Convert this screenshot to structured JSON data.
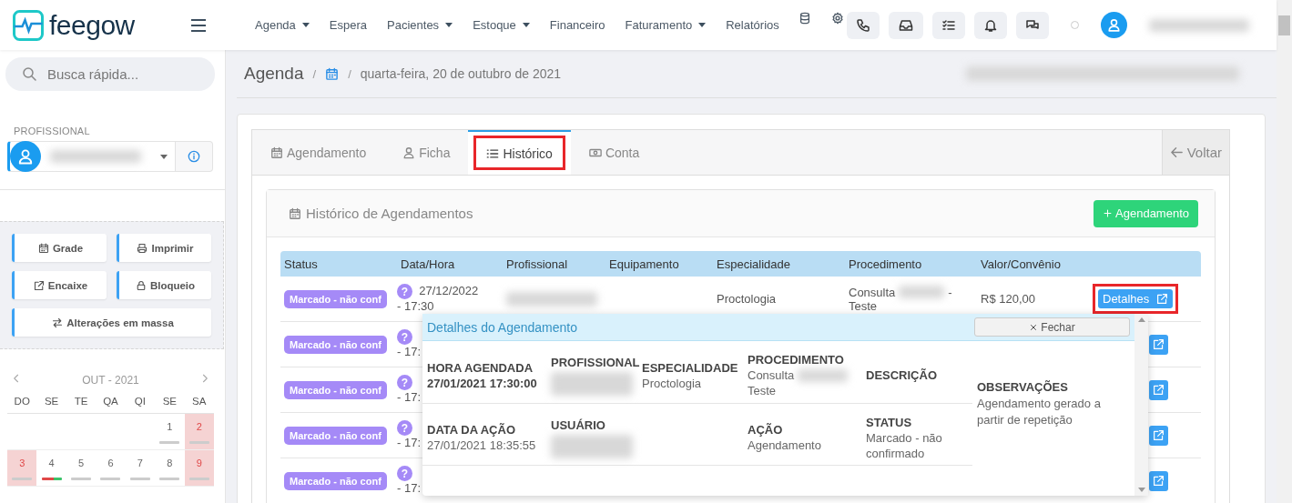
{
  "brand": {
    "name": "feegow"
  },
  "nav": [
    {
      "label": "Agenda",
      "dropdown": true
    },
    {
      "label": "Espera",
      "dropdown": false
    },
    {
      "label": "Pacientes",
      "dropdown": true
    },
    {
      "label": "Estoque",
      "dropdown": true
    },
    {
      "label": "Financeiro",
      "dropdown": false
    },
    {
      "label": "Faturamento",
      "dropdown": true
    },
    {
      "label": "Relatórios",
      "dropdown": false
    }
  ],
  "search": {
    "placeholder": "Busca rápida..."
  },
  "sidebar": {
    "professional_label": "PROFISSIONAL",
    "actions": [
      {
        "label": "Grade",
        "wide": false
      },
      {
        "label": "Imprimir",
        "wide": false
      },
      {
        "label": "Encaixe",
        "wide": false
      },
      {
        "label": "Bloqueio",
        "wide": false
      },
      {
        "label": "Alterações em massa",
        "wide": true
      }
    ],
    "calendar": {
      "month": "OUT - 2021",
      "weekdays": [
        "DO",
        "SE",
        "TE",
        "QA",
        "QI",
        "SE",
        "SA"
      ],
      "days": [
        {
          "day": "1",
          "weekend": false,
          "kind": "plain"
        },
        {
          "day": "2",
          "weekend": true,
          "kind": "plain"
        },
        {
          "day": "3",
          "weekend": true,
          "kind": "plain"
        },
        {
          "day": "4",
          "weekend": false,
          "kind": "split"
        },
        {
          "day": "5",
          "weekend": false,
          "kind": "plain"
        },
        {
          "day": "6",
          "weekend": false,
          "kind": "plain"
        },
        {
          "day": "7",
          "weekend": false,
          "kind": "plain"
        },
        {
          "day": "8",
          "weekend": false,
          "kind": "plain"
        },
        {
          "day": "9",
          "weekend": true,
          "kind": "plain"
        }
      ]
    }
  },
  "breadcrumb": {
    "title": "Agenda",
    "separator_1": "/",
    "separator_2": "/",
    "date": "quarta-feira, 20 de outubro de 2021"
  },
  "tabs": [
    {
      "label": "Agendamento",
      "selected": false,
      "highlighted": false
    },
    {
      "label": "Ficha",
      "selected": false,
      "highlighted": false
    },
    {
      "label": "Histórico",
      "selected": true,
      "highlighted": true
    },
    {
      "label": "Conta",
      "selected": false,
      "highlighted": false
    }
  ],
  "back_button": "Voltar",
  "panel": {
    "title": "Histórico de Agendamentos",
    "add_button": "Agendamento"
  },
  "table": {
    "columns": [
      "Status",
      "Data/Hora",
      "Profissional",
      "Equipamento",
      "Especialidade",
      "Procedimento",
      "Valor/Convênio"
    ],
    "rows": [
      {
        "status": "Marcado - não conf",
        "help": "?",
        "date": "27/12/2022",
        "time": "- 17:30",
        "specialty": "Proctologia",
        "procedure": "Consulta",
        "procedure_dash": "-",
        "procedure_end": "Teste",
        "value": "R$ 120,00",
        "action": "Detalhes",
        "highlighted": true
      },
      {
        "status": "Marcado - não conf",
        "help": "?",
        "time": "- 17:",
        "highlighted": false
      },
      {
        "status": "Marcado - não conf",
        "help": "?",
        "time": "- 17:",
        "highlighted": false
      },
      {
        "status": "Marcado - não conf",
        "help": "?",
        "time": "- 17:",
        "highlighted": false
      },
      {
        "status": "Marcado - não conf",
        "help": "?",
        "time": "- 17:",
        "highlighted": false
      }
    ]
  },
  "popup": {
    "title": "Detalhes do Agendamento",
    "close_button": "Fechar",
    "rows": [
      [
        {
          "label": "HORA AGENDADA",
          "kind": "emphasis",
          "value": "27/01/2021 17:30:00"
        },
        {
          "label": "PROFISSIONAL",
          "kind": "redacted"
        },
        {
          "label": "ESPECIALIDADE",
          "kind": "plain",
          "value": "Proctologia"
        },
        {
          "label": "PROCEDIMENTO",
          "kind": "mixed",
          "value": "Consulta",
          "value_end": "Teste"
        },
        {
          "label": "DESCRIÇÃO",
          "kind": "label"
        }
      ],
      [
        {
          "label": "DATA DA AÇÃO",
          "kind": "plain",
          "value": "27/01/2021 18:35:55"
        },
        {
          "label": "USUÁRIO",
          "kind": "redacted"
        },
        {
          "kind": "empty"
        },
        {
          "label": "AÇÃO",
          "kind": "plain",
          "value": "Agendamento"
        },
        {
          "label": "STATUS",
          "kind": "plain",
          "value": "Marcado - não confirmado"
        }
      ]
    ],
    "notes": {
      "label": "OBSERVAÇÕES",
      "value": "Agendamento gerado a partir de repetição"
    }
  }
}
